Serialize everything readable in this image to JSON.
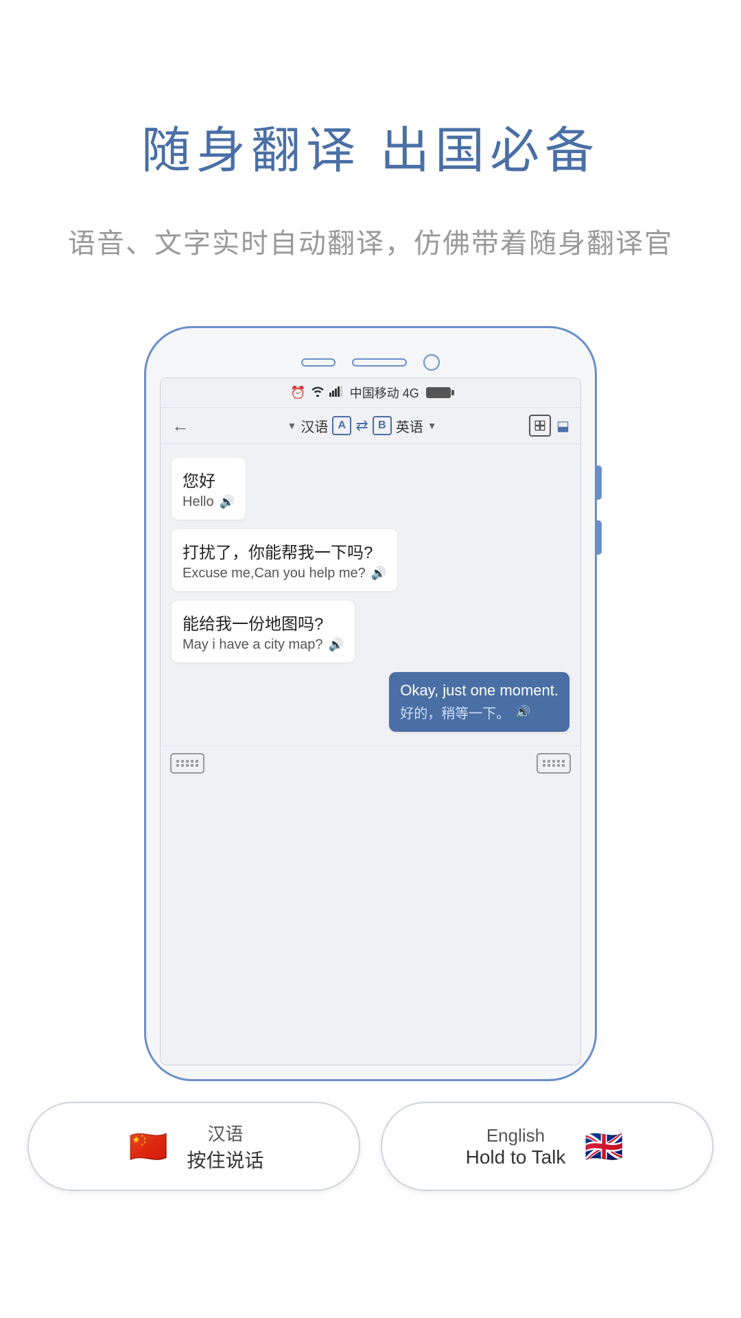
{
  "header": {
    "main_title": "随身翻译 出国必备",
    "subtitle": "语音、文字实时自动翻译，仿佛带着随身翻译官"
  },
  "phone": {
    "status_bar": {
      "alarm_icon": "⏰",
      "wifi_icon": "📶",
      "signal_icon": "📶",
      "carrier": "中国移动 4G"
    },
    "nav": {
      "back_icon": "←",
      "lang_from": "汉语",
      "lang_from_arrow": "▼",
      "lang_a_label": "A",
      "swap_icon": "⇄",
      "lang_b_label": "B",
      "lang_to": "英语",
      "lang_to_arrow": "▼"
    },
    "messages": [
      {
        "id": "msg1",
        "side": "left",
        "original": "您好",
        "translation": "Hello"
      },
      {
        "id": "msg2",
        "side": "left",
        "original": "打扰了，你能帮我一下吗?",
        "translation": "Excuse me,Can you help me?"
      },
      {
        "id": "msg3",
        "side": "left",
        "original": "能给我一份地图吗?",
        "translation": "May i have a city map?"
      },
      {
        "id": "msg4",
        "side": "right",
        "original": "Okay, just one moment.",
        "translation": "好的，稍等一下。"
      }
    ]
  },
  "bottom_buttons": {
    "chinese": {
      "flag": "🇨🇳",
      "lang": "汉语",
      "action": "按住说话"
    },
    "english": {
      "flag": "🇬🇧",
      "lang": "English",
      "action": "Hold to Talk"
    }
  },
  "colors": {
    "accent_blue": "#4a6fa5",
    "bubble_right_bg": "#4a6fa5",
    "bubble_left_bg": "#ffffff",
    "phone_border": "#6a8fc8",
    "bg": "#ffffff"
  }
}
